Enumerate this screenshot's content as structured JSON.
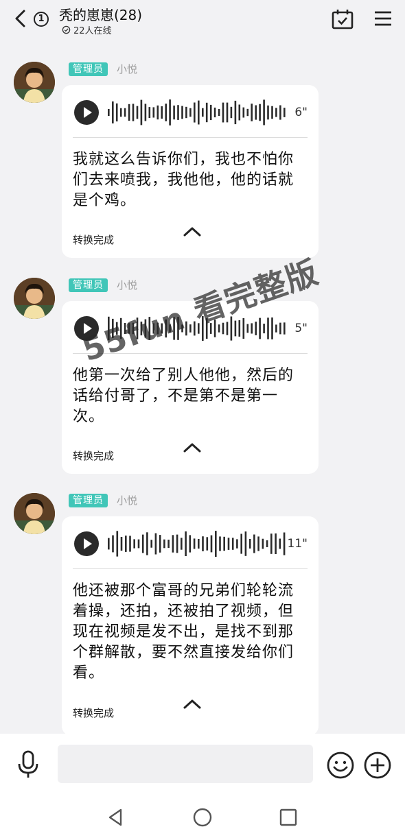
{
  "header": {
    "back_icon": "chevron-left-icon",
    "unread_count": "1",
    "title": "秃的崽崽(28)",
    "online_text": "22人在线",
    "online_icon": "check-circle-icon",
    "calendar_icon": "calendar-check-icon",
    "menu_icon": "hamburger-menu-icon"
  },
  "messages": [
    {
      "role": "管理员",
      "sender": "小悦",
      "duration": "6\"",
      "transcript": "我就这么告诉你们，我也不怕你们去来喷我，我他他，他的话就是个鸡。",
      "status": "转换完成"
    },
    {
      "role": "管理员",
      "sender": "小悦",
      "duration": "5\"",
      "transcript": "他第一次给了别人他他，然后的话给付哥了，不是第不是第一次。",
      "status": "转换完成"
    },
    {
      "role": "管理员",
      "sender": "小悦",
      "duration": "11\"",
      "transcript": "他还被那个富哥的兄弟们轮轮流着操，还拍，还被拍了视频，但现在视频是发不出，是找不到那个群解散，要不然直接发给你们看。",
      "status": "转换完成"
    }
  ],
  "watermark": "55fun 看完整版",
  "input": {
    "placeholder": "",
    "mic_icon": "microphone-icon",
    "emoji_icon": "smiley-icon",
    "plus_icon": "plus-circle-icon"
  },
  "navbar": {
    "back_icon": "triangle-back-icon",
    "home_icon": "circle-home-icon",
    "recent_icon": "square-recent-icon"
  },
  "colors": {
    "role_badge": "#41c6b8",
    "background": "#f2f2f4",
    "bubble": "#ffffff"
  }
}
